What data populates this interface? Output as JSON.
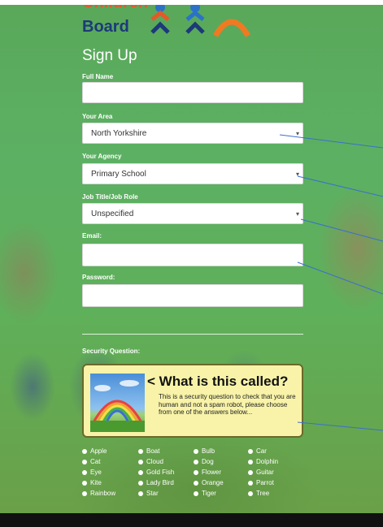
{
  "logo": {
    "top_text": "Children",
    "board": "Board"
  },
  "title": "Sign Up",
  "form": {
    "full_name": {
      "label": "Full Name",
      "value": ""
    },
    "area": {
      "label": "Your Area",
      "value": "North Yorkshire"
    },
    "agency": {
      "label": "Your Agency",
      "value": "Primary School"
    },
    "job": {
      "label": "Job Title/Job Role",
      "value": "Unspecified"
    },
    "email": {
      "label": "Email:",
      "value": ""
    },
    "password": {
      "label": "Password:",
      "value": ""
    }
  },
  "security": {
    "label": "Security Question:",
    "title": "What is this called?",
    "text": "This is a security question to check that you are human and not a spam robot, please choose from one of the answers below...",
    "options": [
      [
        "Apple",
        "Boat",
        "Bulb",
        "Car"
      ],
      [
        "Cat",
        "Cloud",
        "Dog",
        "Dolphin"
      ],
      [
        "Eye",
        "Gold Fish",
        "Flower",
        "Guitar"
      ],
      [
        "Kite",
        "Lady Bird",
        "Orange",
        "Parrot"
      ],
      [
        "Rainbow",
        "Star",
        "Tiger",
        "Tree"
      ]
    ]
  },
  "colors": {
    "logo_blue": "#1c3a7a",
    "logo_orange": "#e25a2a",
    "captcha_bg": "#f8f3a8",
    "annotation_line": "#3a6fd0"
  }
}
